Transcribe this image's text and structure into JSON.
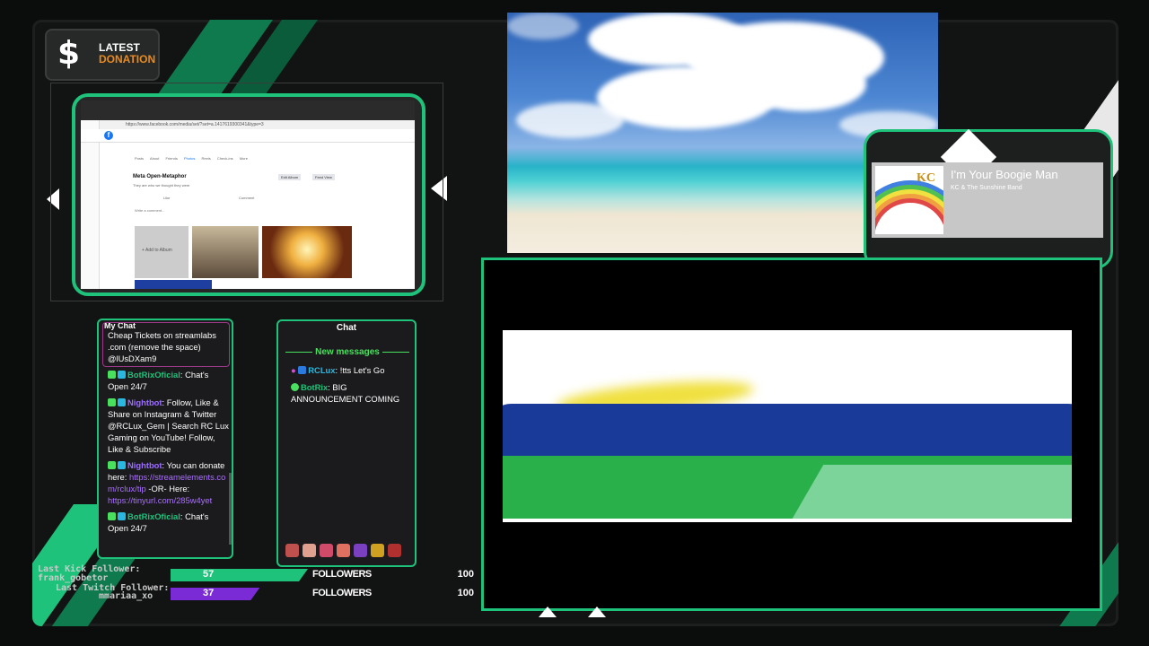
{
  "donation": {
    "symbol": "$",
    "line1": "LATEST",
    "line2": "DONATION"
  },
  "browser": {
    "url": "https://www.facebook.com/media/set/?set=a.1417619300341&type=3",
    "logo": "f",
    "tabs": [
      "Posts",
      "About",
      "Friends",
      "Photos",
      "Reels",
      "Check-ins",
      "More"
    ],
    "page_name": "Meta Open-Metaphor",
    "subtitle": "They are who we thought they were",
    "like": "Like",
    "comment": "Comment",
    "add_album": "+ Add to Album",
    "write_comment": "Write a comment...",
    "edit_album": "Edit Album",
    "feed_view": "Feed View"
  },
  "my_chat": {
    "title": "My Chat",
    "messages": [
      {
        "text": "Cheap Tickets on streamlabs .com (remove the space) @lUsDXam9"
      },
      {
        "user": "BotRixOficial",
        "text": ": Chat's Open 24/7"
      },
      {
        "user": "Nightbot",
        "text": ": Follow, Like & Share on Instagram & Twitter @RCLux_Gem | Search RC Lux Gaming on YouTube! Follow, Like & Subscribe"
      },
      {
        "user": "Nightbot",
        "text": ": You can donate here: ",
        "link1": "https://streamelements.com/rclux/tip",
        "mid": " -OR- Here: ",
        "link2": "https://tinyurl.com/285w4yet"
      },
      {
        "user": "BotRixOficial",
        "text": ": Chat's Open 24/7"
      }
    ]
  },
  "chat": {
    "title": "Chat",
    "new_messages": "New messages",
    "messages": [
      {
        "user": "RCLux",
        "text": ": !tts Let's Go"
      },
      {
        "user": "BotRix",
        "text": ": BIG ANNOUNCEMENT COMING"
      }
    ]
  },
  "music": {
    "song": "I'm Your Boogie Man",
    "artist": "KC & The Sunshine Band",
    "art_label": "KC"
  },
  "goals": [
    {
      "ticker": "Last Kick Follower:",
      "ticker2": "frank_gobetor",
      "count": "57",
      "label": "FOLLOWERS",
      "max": "100",
      "color": "#1ec27a",
      "progress": 0.57
    },
    {
      "ticker": "Last Twitch Follower:",
      "ticker2": "mmariaa_xo",
      "count": "37",
      "label": "FOLLOWERS",
      "max": "100",
      "color": "#7a2bd6",
      "progress": 0.37
    }
  ],
  "colors": {
    "accent": "#1ec27a",
    "twitch": "#7a2bd6",
    "donation": "#e88a21"
  }
}
